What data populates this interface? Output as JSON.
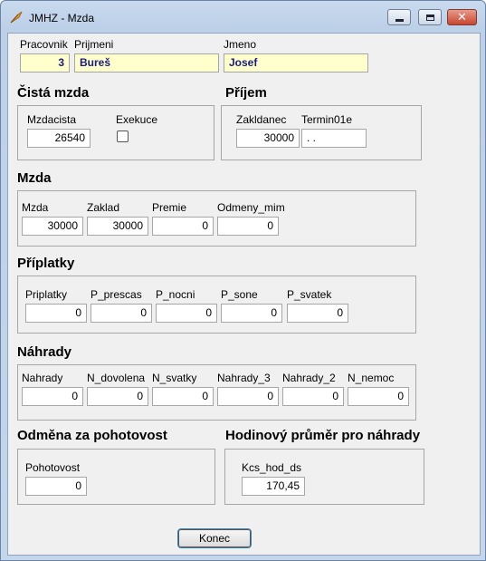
{
  "window": {
    "title": "JMHZ - Mzda"
  },
  "person": {
    "pracovnik_label": "Pracovnik",
    "pracovnik_value": "3",
    "prijmeni_label": "Prijmeni",
    "prijmeni_value": "Bureš",
    "jmeno_label": "Jmeno",
    "jmeno_value": "Josef"
  },
  "cista_mzda": {
    "heading": "Čistá mzda",
    "mzdacista_label": "Mzdacista",
    "mzdacista_value": "26540",
    "exekuce_label": "Exekuce",
    "exekuce_checked": false
  },
  "prijem": {
    "heading": "Příjem",
    "zakldanec_label": "Zakldanec",
    "zakldanec_value": "30000",
    "termin_label": "Termin01e",
    "termin_value": ". ."
  },
  "mzda": {
    "heading": "Mzda",
    "fields": [
      {
        "label": "Mzda",
        "value": "30000"
      },
      {
        "label": "Zaklad",
        "value": "30000"
      },
      {
        "label": "Premie",
        "value": "0"
      },
      {
        "label": "Odmeny_mim",
        "value": "0"
      }
    ]
  },
  "priplatky": {
    "heading": "Příplatky",
    "fields": [
      {
        "label": "Priplatky",
        "value": "0"
      },
      {
        "label": "P_prescas",
        "value": "0"
      },
      {
        "label": "P_nocni",
        "value": "0"
      },
      {
        "label": "P_sone",
        "value": "0"
      },
      {
        "label": "P_svatek",
        "value": "0"
      }
    ]
  },
  "nahrady": {
    "heading": "Náhrady",
    "fields": [
      {
        "label": "Nahrady",
        "value": "0"
      },
      {
        "label": "N_dovolena",
        "value": "0"
      },
      {
        "label": "N_svatky",
        "value": "0"
      },
      {
        "label": "Nahrady_3",
        "value": "0"
      },
      {
        "label": "Nahrady_2",
        "value": "0"
      },
      {
        "label": "N_nemoc",
        "value": "0"
      }
    ]
  },
  "pohotovost": {
    "heading": "Odměna za pohotovost",
    "label": "Pohotovost",
    "value": "0"
  },
  "prumer": {
    "heading": "Hodinový průměr pro náhrady",
    "label": "Kcs_hod_ds",
    "value": "170,45"
  },
  "buttons": {
    "konec": "Konec"
  },
  "colors": {
    "highlight_field": "#ffffcc",
    "frame": "#c4d6ec"
  },
  "icons": {
    "app": "feather-icon",
    "minimize": "minimize-icon",
    "maximize": "maximize-icon",
    "close": "close-icon"
  }
}
